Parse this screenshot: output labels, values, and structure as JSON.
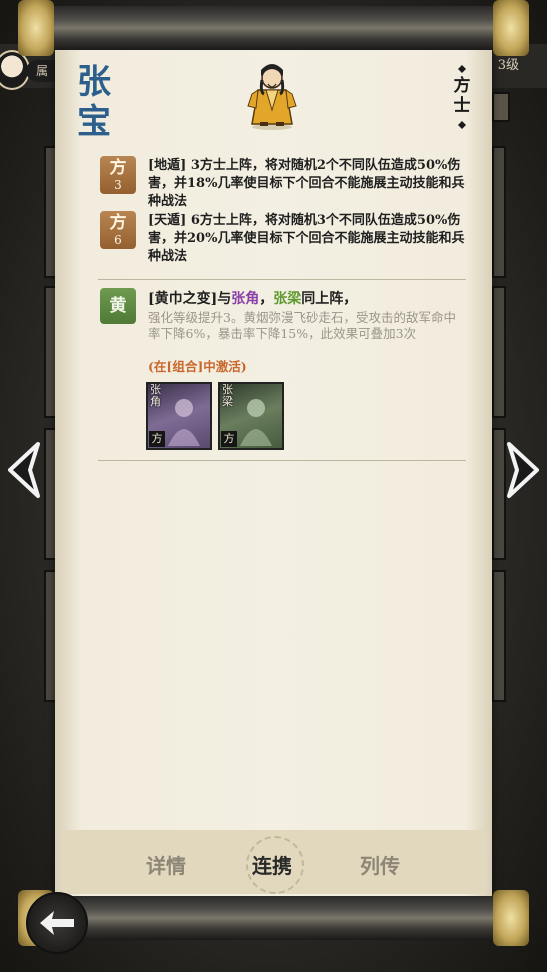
{
  "hero": {
    "name": "张宝",
    "class": "方士"
  },
  "top": {
    "attr_label": "属",
    "level_label": "3级"
  },
  "skills": [
    {
      "icon": "方",
      "count": "3",
      "text": "[地遁] 3方士上阵，将对随机2个不同队伍造成50%伤害，并18%几率使目标下个回合不能施展主动技能和兵种战法"
    },
    {
      "icon": "方",
      "count": "6",
      "text": "[天遁] 6方士上阵，将对随机3个不同队伍造成50%伤害，并20%几率使目标下个回合不能施展主动技能和兵种战法"
    }
  ],
  "combo": {
    "icon": "黄",
    "title_prefix": "[黄巾之变]与",
    "partner1": "张角",
    "sep": "，",
    "partner2": "张梁",
    "title_suffix": "同上阵，",
    "desc": "强化等级提升3。黄烟弥漫飞砂走石，受攻击的敌军命中率下降6%，暴击率下降15%，此效果可叠加3次",
    "activate": "(在[组合]中激活)",
    "cards": [
      {
        "name": "张角",
        "class": "方"
      },
      {
        "name": "张梁",
        "class": "方"
      }
    ]
  },
  "tabs": {
    "details": "详情",
    "combo": "连携",
    "biography": "列传"
  },
  "colors": {
    "name": "#2c5f8c",
    "partner1": "#8b3fa8",
    "partner2": "#5f9a2e",
    "activate": "#c8662c"
  }
}
